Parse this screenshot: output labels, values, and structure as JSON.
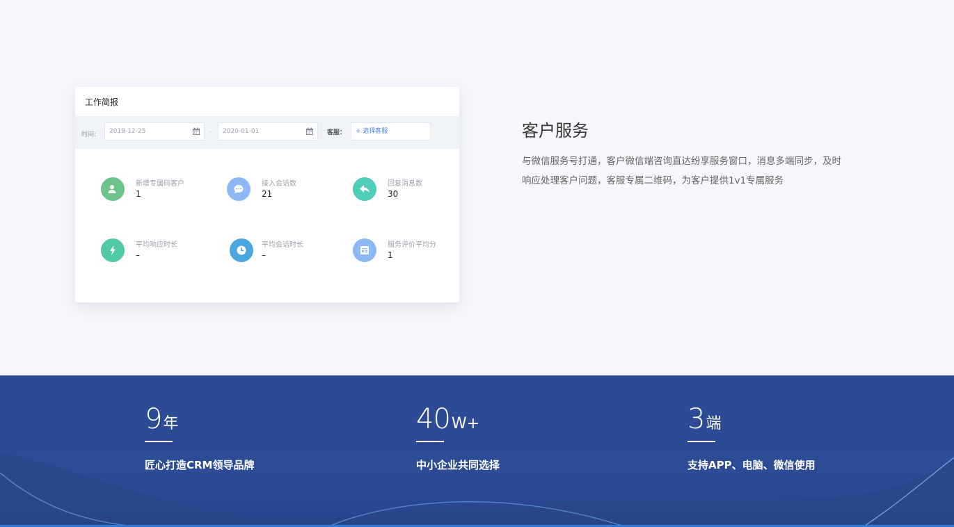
{
  "card": {
    "title": "工作简报",
    "filter": {
      "time_label": "时间:",
      "start_date": "2019-12-25",
      "separator": "-",
      "end_date": "2020-01-01",
      "service_label": "客服：",
      "select_service": "+ 选择客服"
    },
    "stats": [
      {
        "label": "新增专属码客户",
        "value": "1",
        "icon": "user-add-icon",
        "color": "#6cc48a"
      },
      {
        "label": "接入会话数",
        "value": "21",
        "icon": "chat-bubble-icon",
        "color": "#8eb8f5"
      },
      {
        "label": "回复消息数",
        "value": "30",
        "icon": "reply-icon",
        "color": "#4ecdb8"
      },
      {
        "label": "平均响应时长",
        "value": "–",
        "icon": "lightning-icon",
        "color": "#4fc9a6"
      },
      {
        "label": "平均会话时长",
        "value": "–",
        "icon": "clock-icon",
        "color": "#4aa6dd"
      },
      {
        "label": "服务评价平均分",
        "value": "1",
        "icon": "rating-form-icon",
        "color": "#8eb8f5"
      }
    ]
  },
  "service": {
    "title": "客户服务",
    "description": "与微信服务号打通，客户微信端咨询直达纷享服务窗口，消息多端同步，及时响应处理客户问题，客服专属二维码，为客户提供1v1专属服务"
  },
  "metrics": [
    {
      "number": "9",
      "unit": "年",
      "desc": "匠心打造CRM领导品牌"
    },
    {
      "number": "40",
      "unit": "W+",
      "desc": "中小企业共同选择"
    },
    {
      "number": "3",
      "unit": "端",
      "desc": "支持APP、电脑、微信使用"
    }
  ],
  "colors": {
    "band": "#2d4a94",
    "page_bg": "#f6f7fb",
    "accent": "#4c7ff0"
  }
}
